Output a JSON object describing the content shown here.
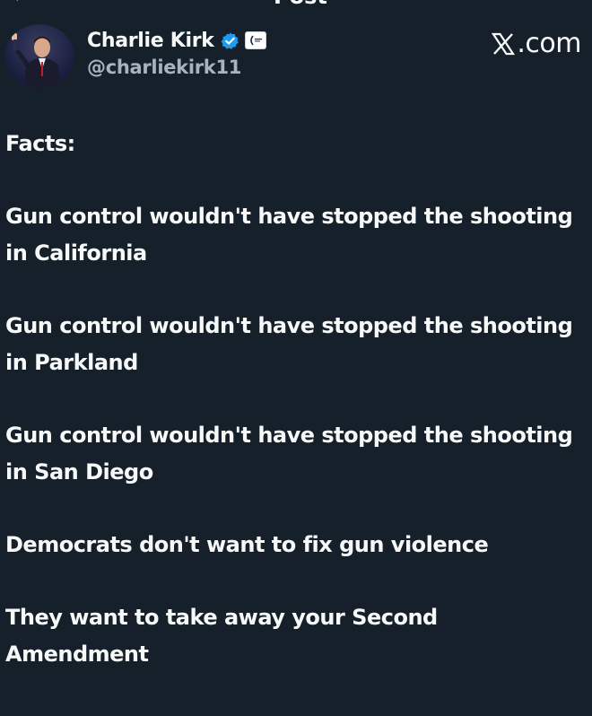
{
  "topbar": {
    "back_icon": "back-arrow-icon",
    "title": "Post"
  },
  "author": {
    "display_name": "Charlie Kirk",
    "handle": "@charliekirk11",
    "verified_icon": "verified-badge-icon",
    "verified_color": "#1d9bf0",
    "affiliate_icon": "affiliate-badge-icon"
  },
  "watermark": {
    "text": ".com",
    "logo_icon": "x-logo-icon"
  },
  "post": {
    "lines": [
      "Facts:",
      "Gun control wouldn't have stopped the shooting in California",
      "Gun control wouldn't have stopped the shooting in Parkland",
      "Gun control wouldn't have stopped the shooting in San Diego",
      "Democrats don't want to fix gun violence",
      "They want to take away your Second Amendment"
    ]
  },
  "colors": {
    "background": "#16202b",
    "text": "#f7f9f9",
    "secondary_text": "#a8b3bd"
  }
}
